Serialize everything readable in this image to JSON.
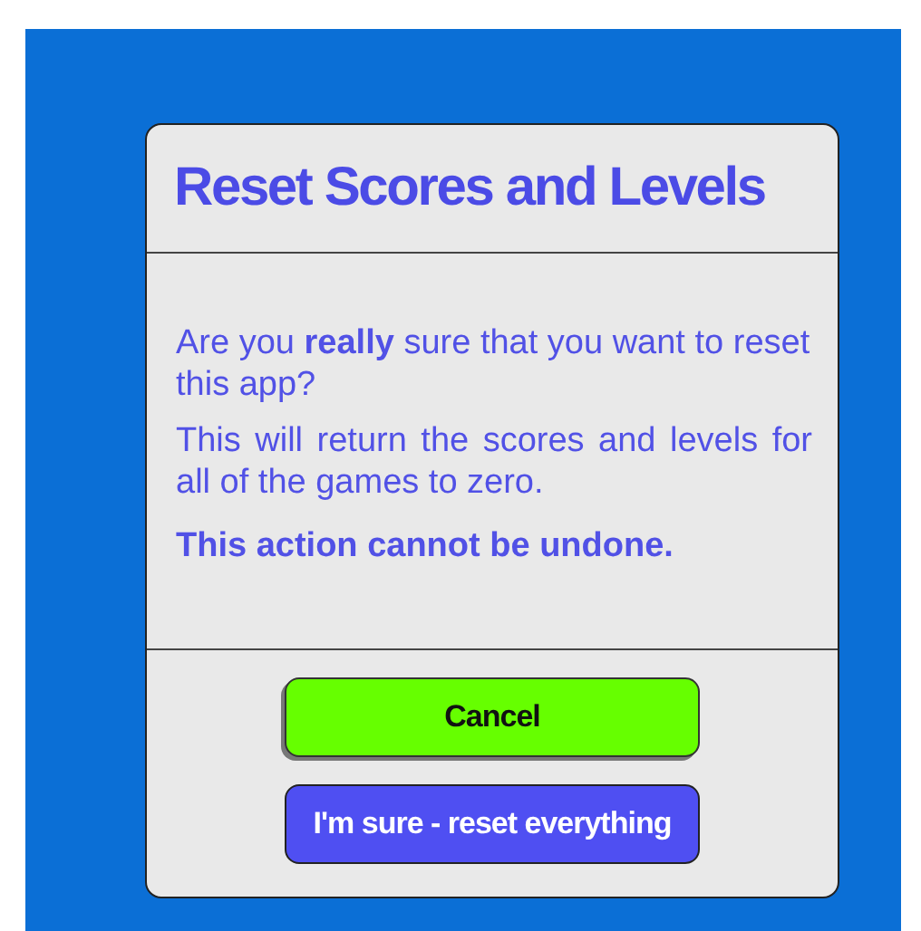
{
  "dialog": {
    "title": "Reset Scores and Levels",
    "paragraphs": [
      {
        "text": "Are you **really** sure that you want to reset this app?",
        "kind": "plain"
      },
      {
        "text": "This will return the scores and levels for all of the games to zero.",
        "kind": "justified"
      },
      {
        "text": "This action cannot be undone.",
        "kind": "warning"
      }
    ],
    "buttons": [
      {
        "label": "Cancel",
        "kind": "cancel"
      },
      {
        "label": "I'm sure - reset everything",
        "kind": "confirm"
      }
    ]
  }
}
